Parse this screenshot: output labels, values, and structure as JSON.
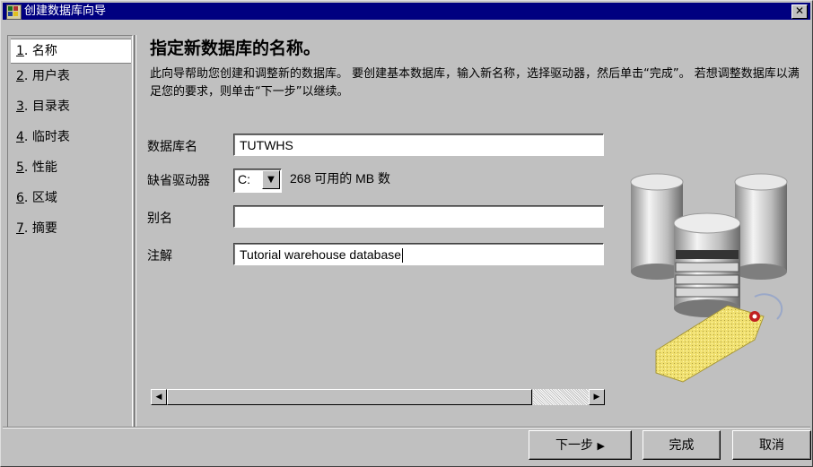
{
  "window": {
    "title": "创建数据库向导",
    "close_symbol": "✕"
  },
  "nav": {
    "items": [
      {
        "num": "1",
        "label": "名称"
      },
      {
        "num": "2",
        "label": "用户表"
      },
      {
        "num": "3",
        "label": "目录表"
      },
      {
        "num": "4",
        "label": "临时表"
      },
      {
        "num": "5",
        "label": "性能"
      },
      {
        "num": "6",
        "label": "区域"
      },
      {
        "num": "7",
        "label": "摘要"
      }
    ]
  },
  "main": {
    "heading": "指定新数据库的名称。",
    "description": "此向导帮助您创建和调整新的数据库。 要创建基本数据库，输入新名称，选择驱动器，然后单击“完成”。 若想调整数据库以满足您的要求，则单击“下一步”以继续。",
    "db_name": {
      "label": "数据库名",
      "value": "TUTWHS"
    },
    "drive": {
      "label": "缺省驱动器",
      "value": "C:",
      "available": "268 可用的 MB 数"
    },
    "alias": {
      "label": "别名",
      "value": ""
    },
    "comment": {
      "label": "注解",
      "value": "Tutorial warehouse database"
    }
  },
  "buttons": {
    "next": "下一步",
    "finish": "完成",
    "cancel": "取消"
  },
  "colors": {
    "titlebar": "#000080",
    "face": "#c0c0c0"
  }
}
